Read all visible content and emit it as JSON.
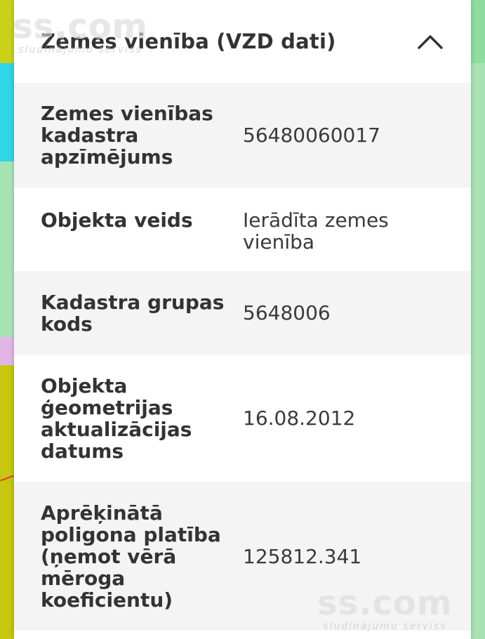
{
  "panel": {
    "title": "Zemes vienība (VZD dati)",
    "collapse_icon": "chevron-up-icon"
  },
  "rows": [
    {
      "label": "Zemes vienības kadastra apzīmējums",
      "value": "56480060017"
    },
    {
      "label": "Objekta veids",
      "value": "Ierādīta zemes vienība"
    },
    {
      "label": "Kadastra grupas kods",
      "value": "5648006"
    },
    {
      "label": "Objekta ģeometrijas aktualizācijas datums",
      "value": "16.08.2012"
    },
    {
      "label": "Aprēķinātā poligona platība (ņemot vērā mēroga koeficientu)",
      "value": "125812.341"
    }
  ],
  "watermark": {
    "brand": "ss.com",
    "tagline": "sludinājumu serviss"
  },
  "colors": {
    "panel_bg": "#ffffff",
    "row_alt_bg": "#f4f4f4",
    "text": "#333333"
  }
}
